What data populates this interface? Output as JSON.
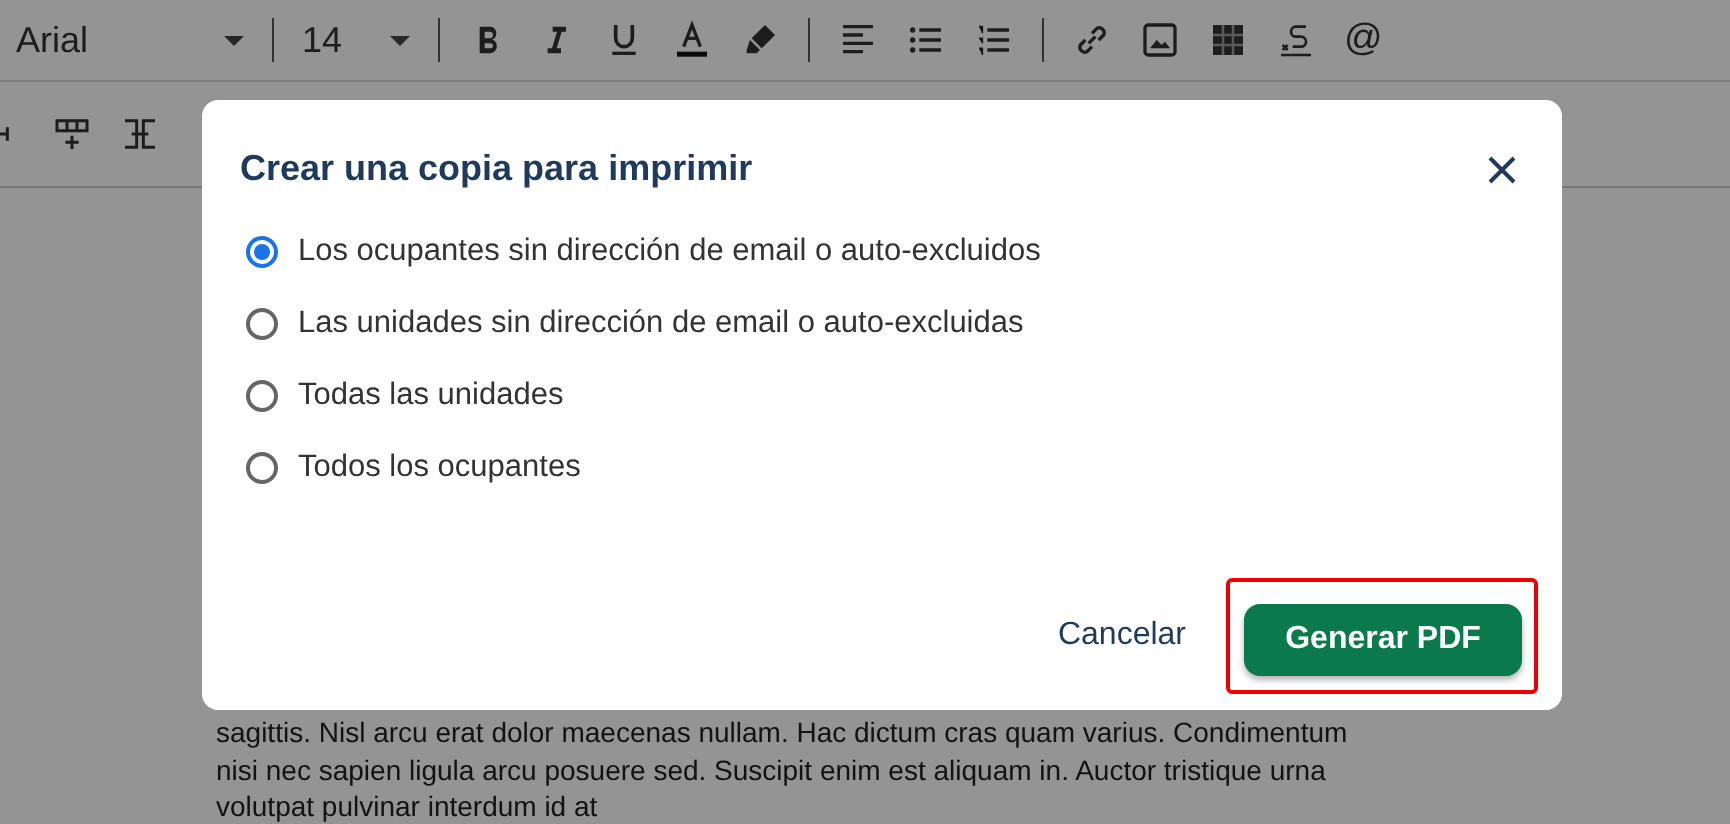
{
  "toolbar": {
    "font": "Arial",
    "size": "14",
    "at_symbol": "@"
  },
  "document": {
    "lines": [
      "sagittis. Nisl arcu erat dolor maecenas nullam. Hac dictum cras quam varius. Condimentum",
      "nisi nec sapien ligula arcu posuere sed. Suscipit enim est aliquam in. Auctor tristique urna",
      "volutpat pulvinar interdum id at"
    ]
  },
  "dialog": {
    "title": "Crear una copia para imprimir",
    "options": [
      {
        "label": "Los ocupantes sin dirección de email o auto-excluidos",
        "selected": true
      },
      {
        "label": "Las unidades sin dirección de email o auto-excluidas",
        "selected": false
      },
      {
        "label": "Todas las unidades",
        "selected": false
      },
      {
        "label": "Todos los ocupantes",
        "selected": false
      }
    ],
    "cancel": "Cancelar",
    "confirm": {
      "label": "Generar PDF",
      "highlighted": true
    }
  }
}
